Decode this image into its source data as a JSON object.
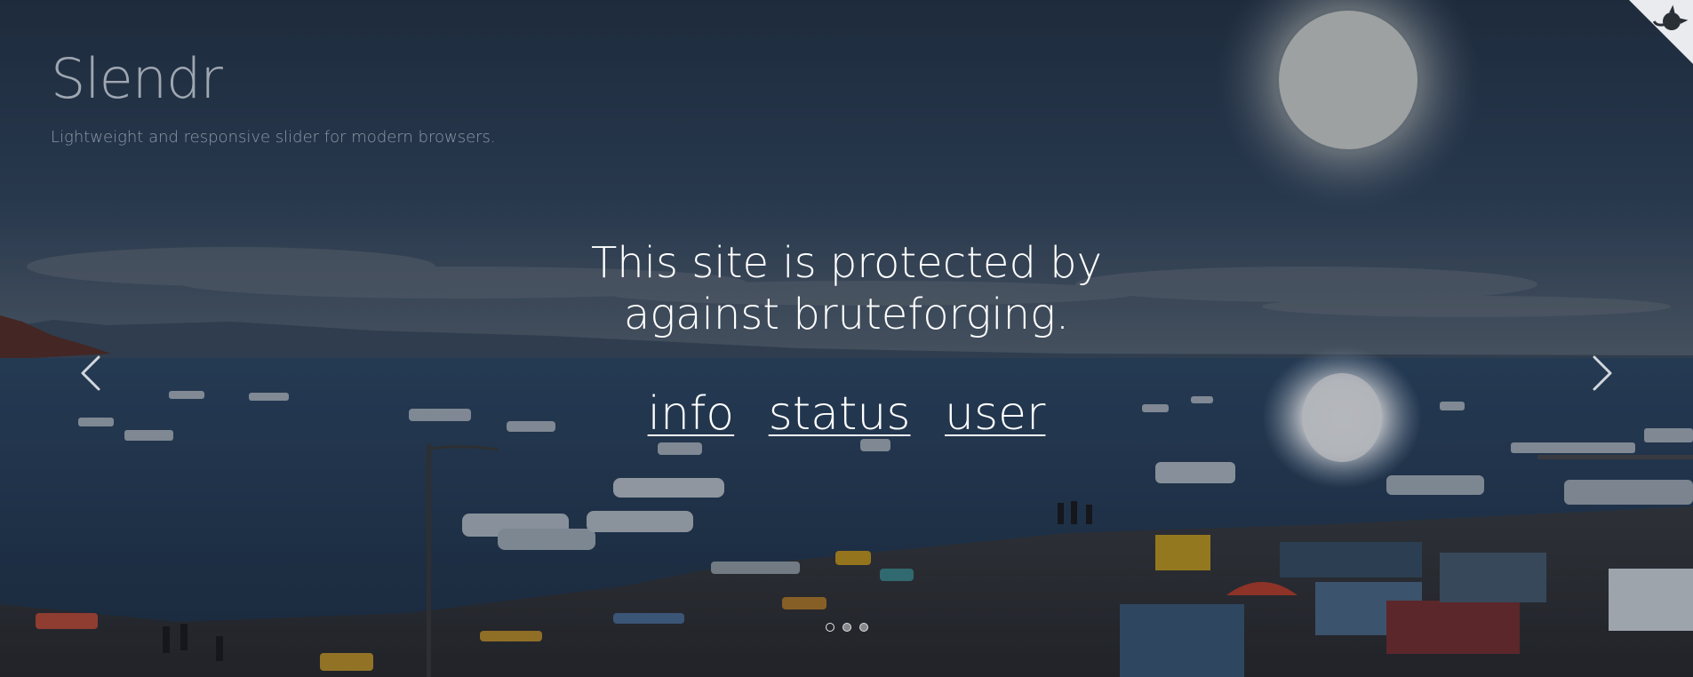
{
  "header": {
    "title": "Slendr",
    "subtitle": "Lightweight and responsive slider for modern browsers."
  },
  "message": {
    "text": "This site is protected by against bruteforging."
  },
  "links": [
    {
      "label": "info"
    },
    {
      "label": "status"
    },
    {
      "label": "user"
    }
  ],
  "slider": {
    "prev_icon": "chevron-left-icon",
    "next_icon": "chevron-right-icon",
    "dots_count": 3,
    "active_dot": 1
  },
  "corner": {
    "icon": "github-octocat-icon"
  },
  "colors": {
    "text": "#ffffff",
    "sky": "#2b3c52",
    "water": "#28405e"
  }
}
